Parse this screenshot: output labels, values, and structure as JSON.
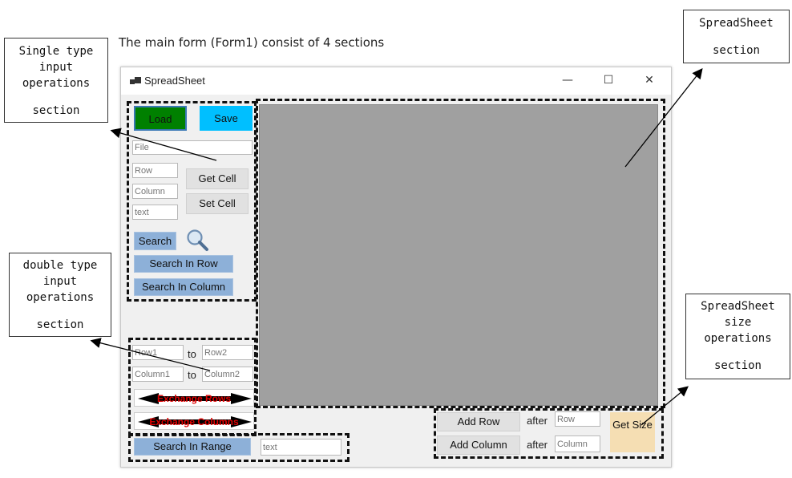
{
  "caption": "The main form (Form1) consist of 4 sections",
  "callouts": {
    "single": {
      "lines": [
        "Single type",
        "input",
        "operations"
      ],
      "tail": "section"
    },
    "double": {
      "lines": [
        "double type",
        "input",
        "operations"
      ],
      "tail": "section"
    },
    "spreadsheet": {
      "lines": [
        "SpreadSheet"
      ],
      "tail": "section"
    },
    "size": {
      "lines": [
        "SpreadSheet",
        "size",
        "operations"
      ],
      "tail": "section"
    }
  },
  "window": {
    "title": "SpreadSheet",
    "minimize": "—",
    "maximize": "☐",
    "close": "✕"
  },
  "single": {
    "load": "Load",
    "save": "Save",
    "file_placeholder": "File",
    "row_placeholder": "Row",
    "column_placeholder": "Column",
    "text_placeholder": "text",
    "get_cell": "Get Cell",
    "set_cell": "Set Cell",
    "search": "Search",
    "search_row": "Search In Row",
    "search_column": "Search In Column"
  },
  "double": {
    "row1_placeholder": "Row1",
    "row2_placeholder": "Row2",
    "col1_placeholder": "Column1",
    "col2_placeholder": "Column2",
    "to": "to",
    "exchange_rows": "Exchange Rows",
    "exchange_columns": "Exchange Columns",
    "search_range": "Search In Range",
    "range_text_placeholder": "text"
  },
  "size": {
    "add_row": "Add Row",
    "add_column": "Add Column",
    "after": "after",
    "row_placeholder": "Row",
    "column_placeholder": "Column",
    "get_size": "Get Size"
  },
  "colors": {
    "load": "#008000",
    "save": "#00bfff",
    "grid": "#a0a0a0",
    "get_size": "#f5deb3",
    "exchange_text": "#e00000"
  }
}
